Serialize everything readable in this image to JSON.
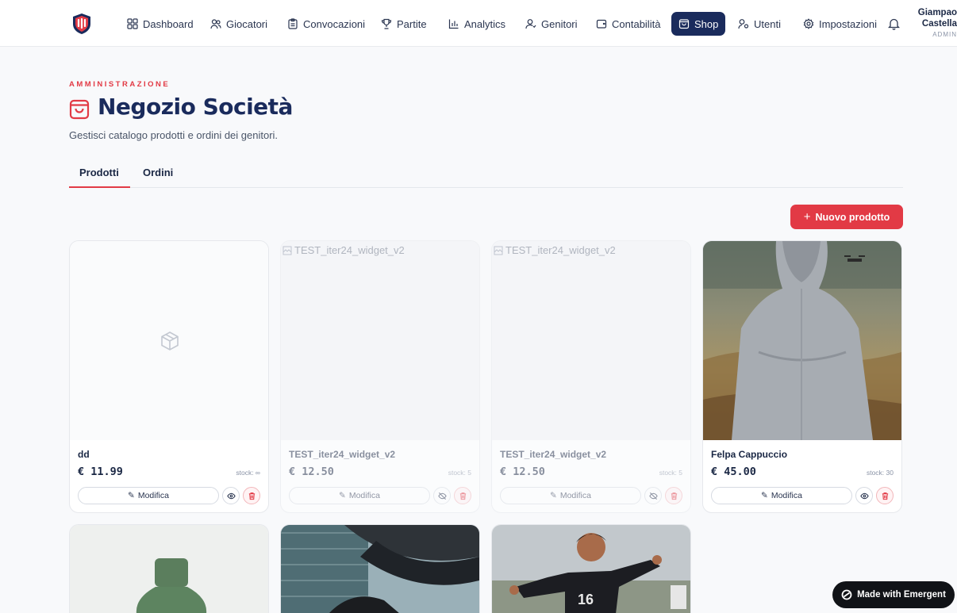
{
  "nav": {
    "items": [
      {
        "label": "Dashboard",
        "icon": "grid-icon"
      },
      {
        "label": "Giocatori",
        "icon": "users-icon"
      },
      {
        "label": "Convocazioni",
        "icon": "clipboard-icon"
      },
      {
        "label": "Partite",
        "icon": "trophy-icon"
      },
      {
        "label": "Analytics",
        "icon": "bar-chart-icon"
      },
      {
        "label": "Genitori",
        "icon": "parents-icon"
      },
      {
        "label": "Contabilità",
        "icon": "wallet-icon"
      },
      {
        "label": "Shop",
        "icon": "shopping-bag-icon",
        "active": true
      },
      {
        "label": "Utenti",
        "icon": "user-key-icon"
      },
      {
        "label": "Impostazioni",
        "icon": "gear-icon"
      }
    ],
    "user": {
      "name_line1": "Giampao",
      "name_line2": "Castella",
      "role": "ADMIN"
    }
  },
  "header": {
    "eyebrow": "AMMINISTRAZIONE",
    "title": "Negozio Società",
    "subtitle": "Gestisci catalogo prodotti e ordini dei genitori."
  },
  "tabs": [
    {
      "label": "Prodotti",
      "active": true
    },
    {
      "label": "Ordini",
      "active": false
    }
  ],
  "actions": {
    "new_product": "Nuovo prodotto"
  },
  "products": [
    {
      "name": "dd",
      "price": "€ 11.99",
      "stock": "stock: ∞",
      "edit": "Modifica",
      "image": "placeholder-box-icon",
      "visible": true
    },
    {
      "name": "TEST_iter24_widget_v2",
      "price": "€ 12.50",
      "stock": "stock: 5",
      "edit": "Modifica",
      "alt": "TEST_iter24_widget_v2",
      "image": "broken-image",
      "visible": false
    },
    {
      "name": "TEST_iter24_widget_v2",
      "price": "€ 12.50",
      "stock": "stock: 5",
      "edit": "Modifica",
      "alt": "TEST_iter24_widget_v2",
      "image": "broken-image",
      "visible": false
    },
    {
      "name": "Felpa Cappuccio",
      "price": "€ 45.00",
      "stock": "stock: 30",
      "edit": "Modifica",
      "image": "hoodie-photo",
      "visible": true
    }
  ],
  "more_products": [
    {
      "image": "green-bottle-photo"
    },
    {
      "image": "sneakers-photo"
    },
    {
      "image": "soccer-player-photo",
      "jersey_number": "16"
    }
  ],
  "badge": {
    "label": "Made with Emergent"
  },
  "colors": {
    "accent": "#e23a45",
    "navy": "#1a2b5c",
    "background": "#f8f9fb"
  }
}
